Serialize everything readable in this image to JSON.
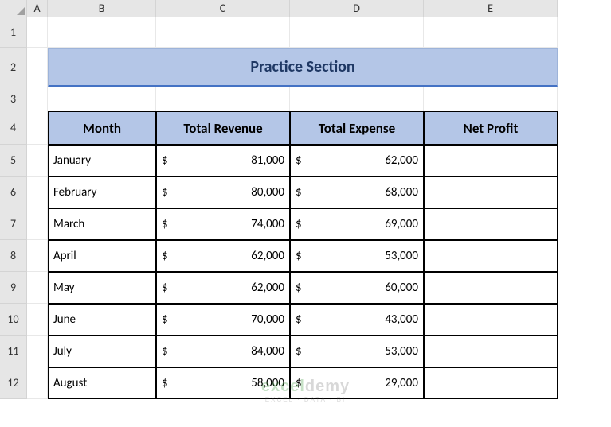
{
  "columns": [
    "",
    "A",
    "B",
    "C",
    "D",
    "E"
  ],
  "rows": [
    "1",
    "2",
    "3",
    "4",
    "5",
    "6",
    "7",
    "8",
    "9",
    "10",
    "11",
    "12"
  ],
  "title": "Practice Section",
  "headers": {
    "month": "Month",
    "revenue": "Total Revenue",
    "expense": "Total Expense",
    "profit": "Net Profit"
  },
  "data": [
    {
      "month": "January",
      "revenue": "81,000",
      "expense": "62,000"
    },
    {
      "month": "February",
      "revenue": "80,000",
      "expense": "68,000"
    },
    {
      "month": "March",
      "revenue": "74,000",
      "expense": "69,000"
    },
    {
      "month": "April",
      "revenue": "62,000",
      "expense": "53,000"
    },
    {
      "month": "May",
      "revenue": "62,000",
      "expense": "60,000"
    },
    {
      "month": "June",
      "revenue": "70,000",
      "expense": "43,000"
    },
    {
      "month": "July",
      "revenue": "84,000",
      "expense": "53,000"
    },
    {
      "month": "August",
      "revenue": "58,000",
      "expense": "29,000"
    }
  ],
  "currency": "$",
  "watermark": {
    "brand1": "excel",
    "brand2": "demy",
    "tag": "EXCEL · DATA · BI"
  }
}
